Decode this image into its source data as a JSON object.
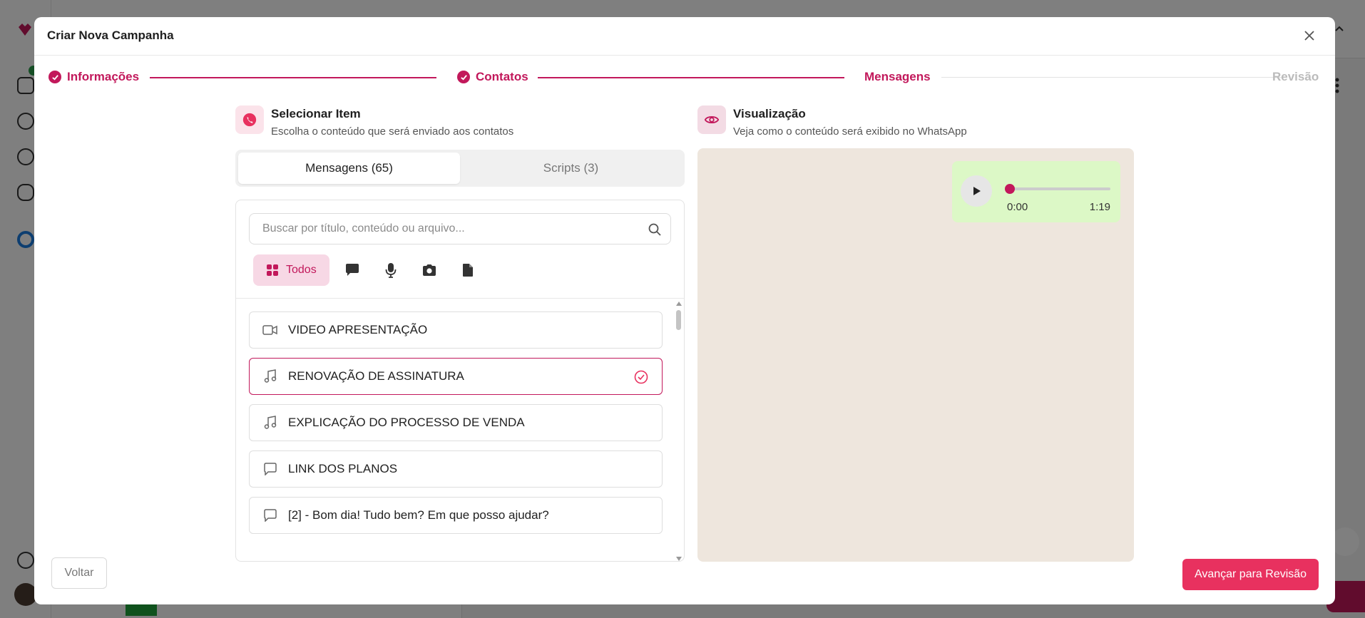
{
  "modal": {
    "title": "Criar Nova Campanha",
    "close_icon": "close-icon"
  },
  "stepper": {
    "steps": [
      {
        "label": "Informações",
        "state": "done"
      },
      {
        "label": "Contatos",
        "state": "done"
      },
      {
        "label": "Mensagens",
        "state": "active"
      },
      {
        "label": "Revisão",
        "state": "pending"
      }
    ]
  },
  "select_item": {
    "title": "Selecionar Item",
    "subtitle": "Escolha o conteúdo que será enviado aos contatos",
    "icon": "whatsapp-icon"
  },
  "tabs": [
    {
      "label": "Mensagens (65)",
      "active": true
    },
    {
      "label": "Scripts (3)",
      "active": false
    }
  ],
  "search": {
    "placeholder": "Buscar por título, conteúdo ou arquivo...",
    "value": ""
  },
  "filters": {
    "all_label": "Todos",
    "types": [
      "chat-bubble-icon",
      "microphone-icon",
      "camera-icon",
      "document-icon"
    ]
  },
  "items": [
    {
      "label": "VIDEO APRESENTAÇÃO",
      "type": "video",
      "selected": false
    },
    {
      "label": "RENOVAÇÃO DE ASSINATURA",
      "type": "audio",
      "selected": true
    },
    {
      "label": "EXPLICAÇÃO DO PROCESSO DE VENDA",
      "type": "audio",
      "selected": false
    },
    {
      "label": "LINK DOS PLANOS",
      "type": "text",
      "selected": false
    },
    {
      "label": "[2] - Bom dia! Tudo bem? Em que posso ajudar?",
      "type": "text",
      "selected": false
    }
  ],
  "preview": {
    "title": "Visualização",
    "subtitle": "Veja como o conteúdo será exibido no WhatsApp",
    "audio": {
      "current": "0:00",
      "duration": "1:19",
      "progress": 0
    }
  },
  "footer": {
    "back_label": "Voltar",
    "next_label": "Avançar para Revisão"
  },
  "colors": {
    "accent": "#c2185b",
    "next_button": "#e8315f",
    "preview_bg": "#eee6dd",
    "bubble_bg": "#dcf8c6"
  }
}
